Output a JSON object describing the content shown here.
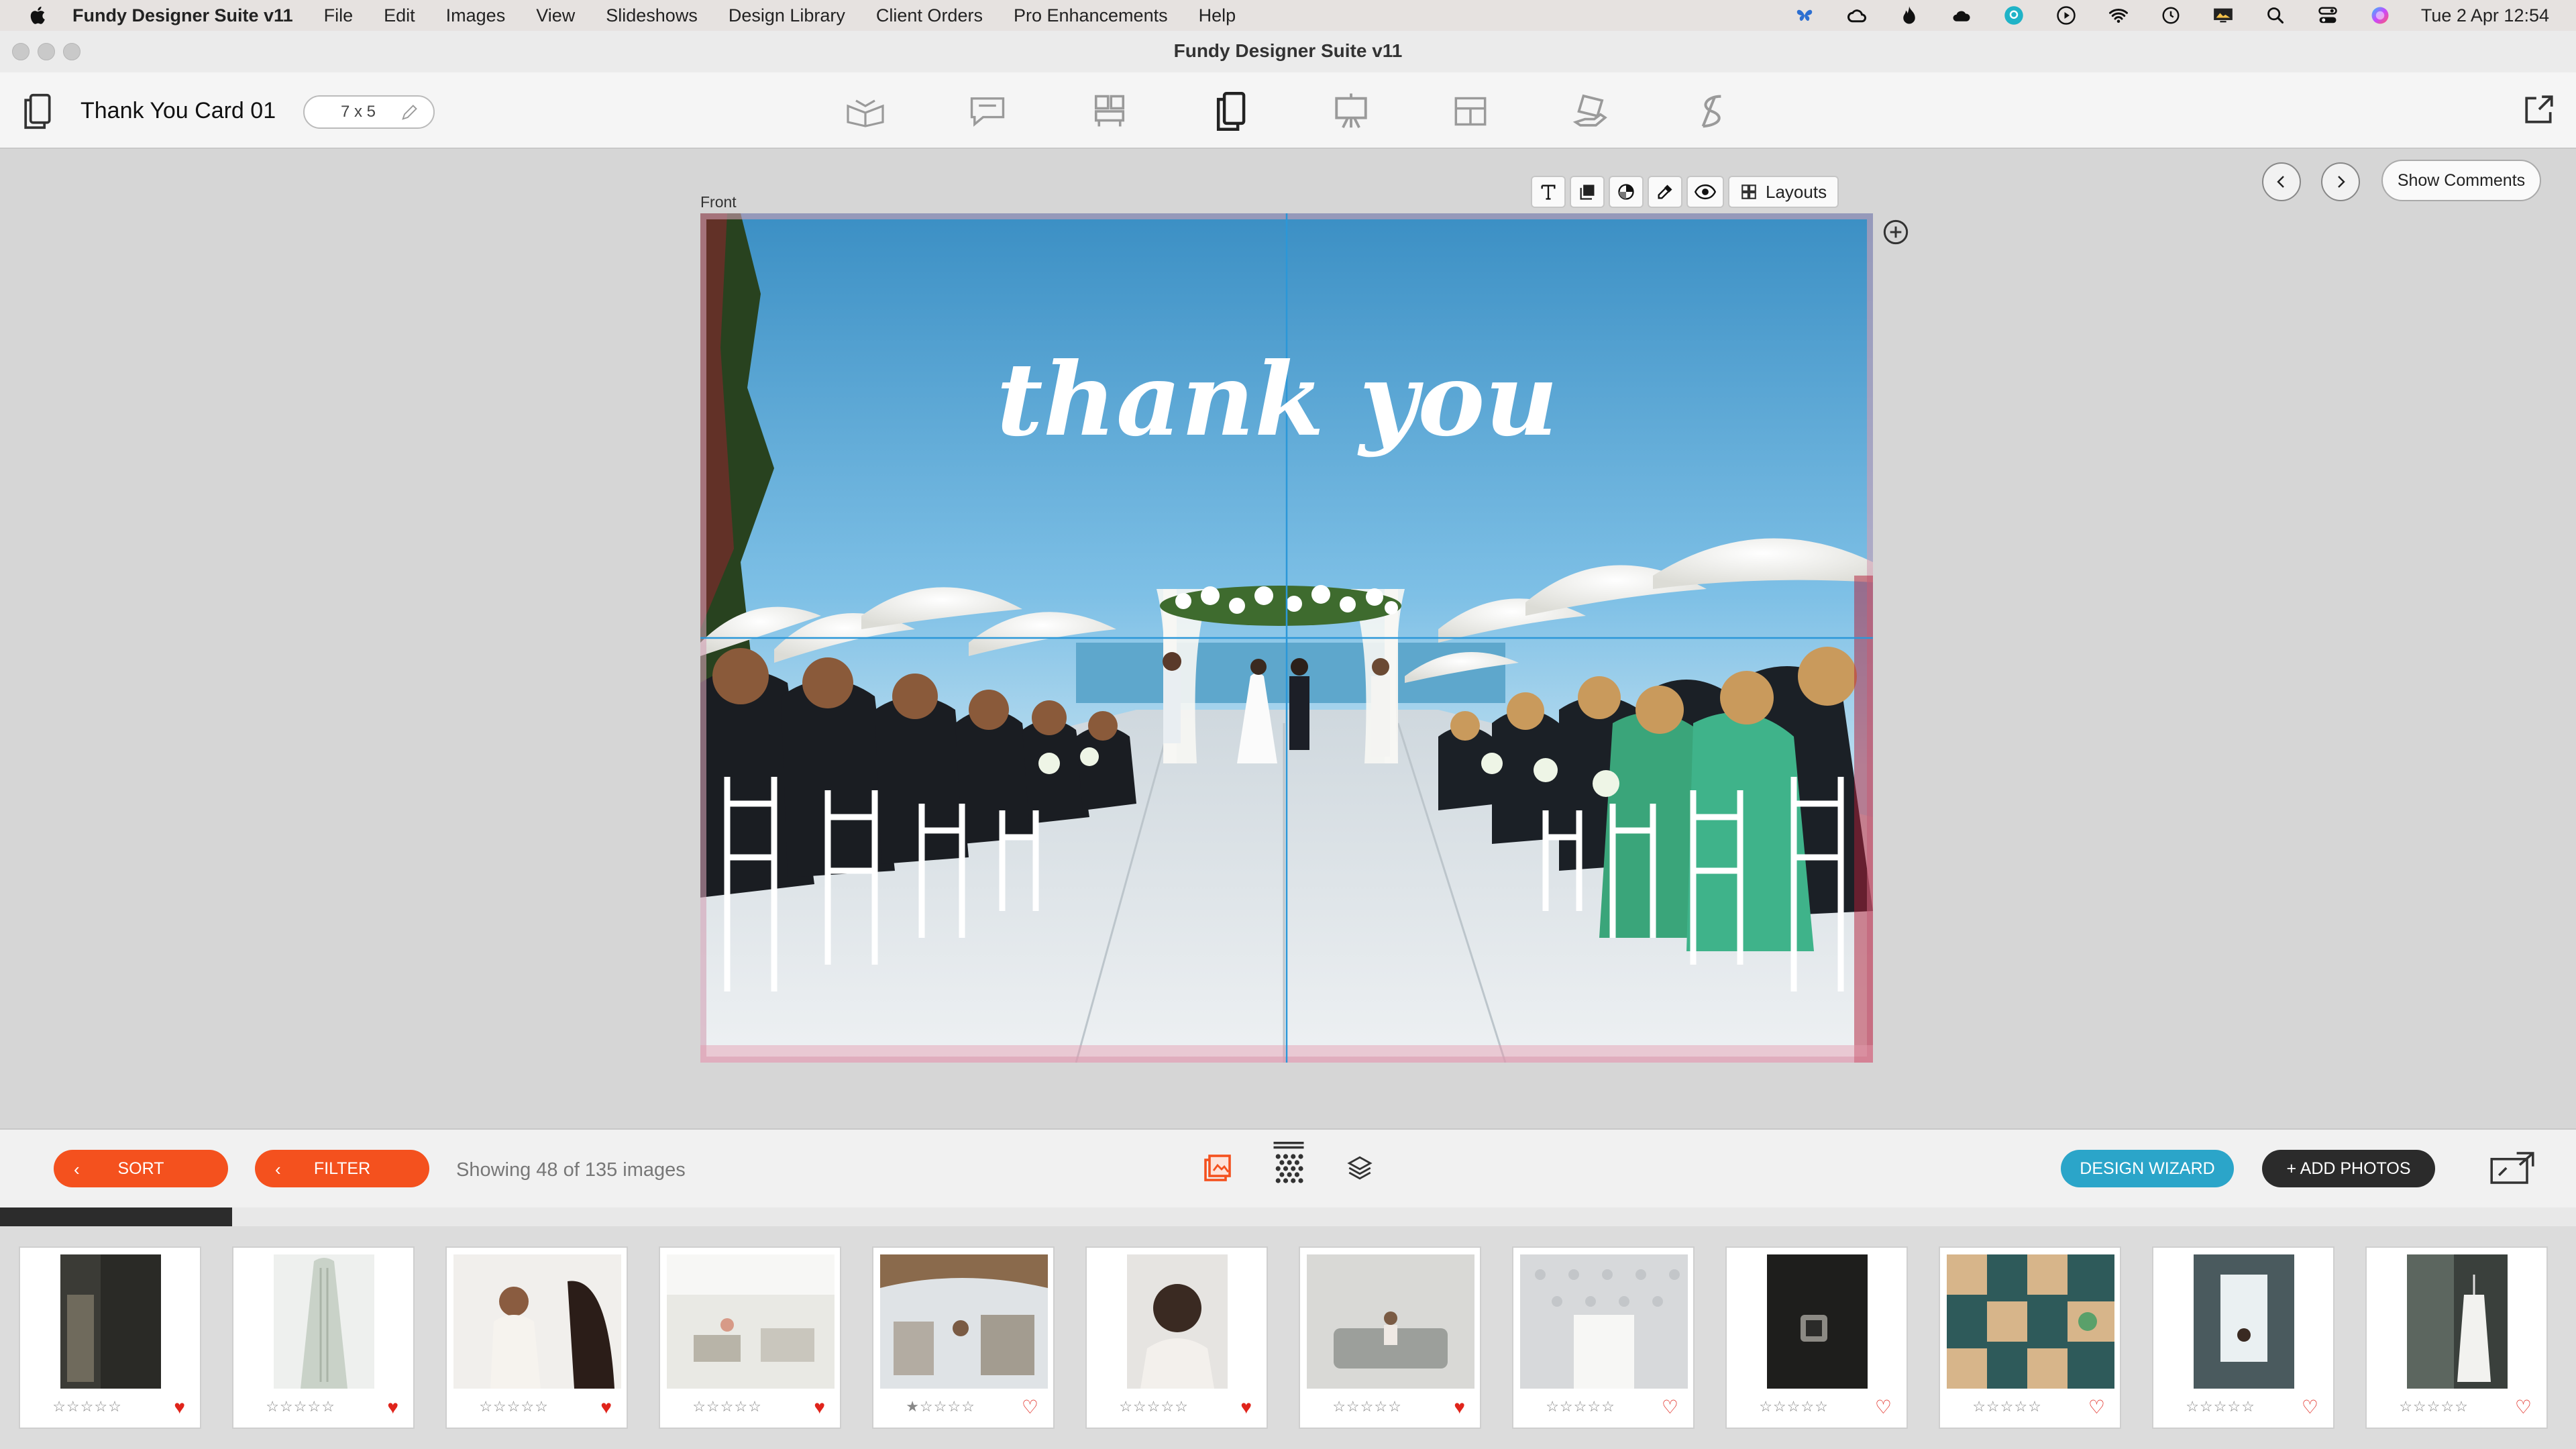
{
  "menubar": {
    "app_name": "Fundy Designer Suite v11",
    "items": [
      "File",
      "Edit",
      "Images",
      "View",
      "Slideshows",
      "Design Library",
      "Client Orders",
      "Pro Enhancements",
      "Help"
    ],
    "status_icons": [
      "butterfly-icon",
      "creative-cloud-icon",
      "flame-icon",
      "cloud-icon",
      "app-circle-icon",
      "play-icon",
      "wifi-icon",
      "time-machine-icon",
      "display-icon",
      "spotlight-search-icon",
      "control-center-icon",
      "siri-icon"
    ],
    "clock": "Tue 2 Apr  12:54"
  },
  "window": {
    "title": "Fundy Designer Suite v11"
  },
  "toolbar": {
    "doc_title": "Thank You Card 01",
    "size": "7 x 5",
    "product_icons": [
      "album-icon",
      "chat-bubble-icon",
      "wall-art-icon",
      "card-icon",
      "easel-icon",
      "layout-icon",
      "hand-tray-icon",
      "slideshow-icon"
    ],
    "active_product": "card-icon"
  },
  "canvas": {
    "side_label": "Front",
    "card_text": "thank you",
    "edit_tools": [
      "text-tool-icon",
      "layer-tool-icon",
      "color-tool-icon",
      "eyedropper-tool-icon",
      "eye-tool-icon"
    ],
    "layouts_label": "Layouts",
    "show_comments": "Show Comments"
  },
  "bottom_bar": {
    "sort_label": "SORT",
    "filter_label": "FILTER",
    "showing_text": "Showing 48 of 135 images",
    "design_wizard": "DESIGN WIZARD",
    "add_photos": "+ ADD PHOTOS",
    "progress_fraction": 0.09
  },
  "filmstrip": {
    "thumbnails": [
      {
        "subject": "mirror in dim room",
        "rating": 0,
        "favorite": true
      },
      {
        "subject": "wedding dress on hanger",
        "rating": 0,
        "favorite": true
      },
      {
        "subject": "bride getting ready",
        "rating": 0,
        "favorite": true
      },
      {
        "subject": "bridal suite lounge",
        "rating": 0,
        "favorite": true
      },
      {
        "subject": "bridesmaids in room",
        "rating": 1,
        "favorite": false
      },
      {
        "subject": "bride hair from behind",
        "rating": 0,
        "favorite": true
      },
      {
        "subject": "bride on sofa",
        "rating": 0,
        "favorite": true
      },
      {
        "subject": "invitation card on headboard",
        "rating": 0,
        "favorite": false
      },
      {
        "subject": "shoes detail",
        "rating": 0,
        "favorite": false
      },
      {
        "subject": "jewellery through glass",
        "rating": 0,
        "favorite": false
      },
      {
        "subject": "bride at window",
        "rating": 0,
        "favorite": false
      },
      {
        "subject": "groom shirt hanging",
        "rating": 0,
        "favorite": false
      }
    ]
  },
  "colors": {
    "accent_orange": "#f4511e",
    "design_wizard_blue": "#2ba5c9",
    "add_photos_dark": "#2b2b2b",
    "favorite_red": "#e0241b"
  }
}
